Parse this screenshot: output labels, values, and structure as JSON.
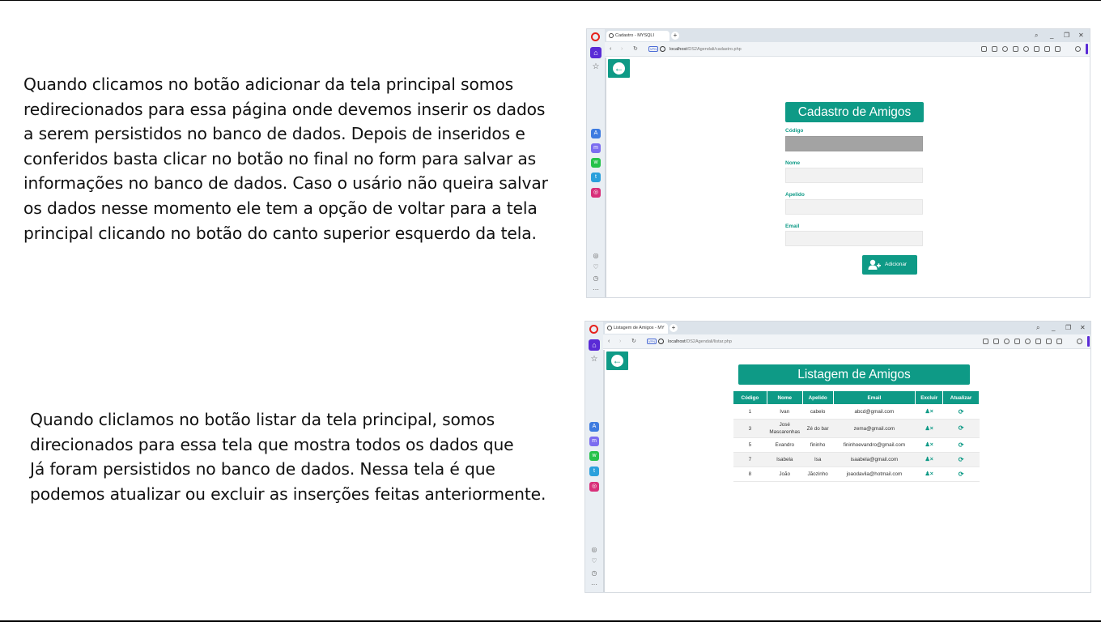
{
  "paragraph1": [
    "Quando clicamos no botão adicionar da tela principal somos",
    "redirecionados para essa página onde devemos inserir os dados",
    "a serem persistidos no banco de dados. Depois de inseridos e",
    "conferidos basta clicar no botão no final no form para salvar as",
    "informações no banco de dados. Caso o usário não queira salvar",
    "os dados nesse momento ele tem a opção de voltar para a tela",
    "principal clicando no botão do canto superior esquerdo da tela."
  ],
  "paragraph2": [
    "Quando cliclamos no botão listar da tela principal, somos",
    "direcionados para essa tela que mostra todos os dados que",
    "Já foram persistidos no banco de dados. Nessa tela é que",
    "podemos atualizar ou excluir as inserções feitas anteriormente."
  ],
  "browser1": {
    "tab_title": "Cadastro - MYSQLI",
    "url_host": "localhost",
    "url_path": "/DS2Agendali/cadastro.php"
  },
  "browser2": {
    "tab_title": "Listagem de Amigos - MY",
    "url_host": "localhost",
    "url_path": "/DS2Agendali/listar.php"
  },
  "cadastro": {
    "title": "Cadastro de Amigos",
    "fields": [
      {
        "label": "Código",
        "value": ""
      },
      {
        "label": "Nome",
        "value": ""
      },
      {
        "label": "Apelido",
        "value": ""
      },
      {
        "label": "Email",
        "value": ""
      }
    ],
    "submit_label": "Adicionar"
  },
  "listagem": {
    "title": "Listagem de Amigos",
    "columns": [
      "Código",
      "Nome",
      "Apelido",
      "Email",
      "Excluir",
      "Atualizar"
    ],
    "rows": [
      {
        "codigo": "1",
        "nome": "Ivan",
        "apelido": "cabelo",
        "email": "abcd@gmail.com"
      },
      {
        "codigo": "3",
        "nome": "José Mascarenhas",
        "apelido": "Zé do bar",
        "email": "zema@gmail.com"
      },
      {
        "codigo": "5",
        "nome": "Evandro",
        "apelido": "fininho",
        "email": "fininhoevandro@gmail.com"
      },
      {
        "codigo": "7",
        "nome": "Isabela",
        "apelido": "Isa",
        "email": "isaabela@gmail.com"
      },
      {
        "codigo": "8",
        "nome": "João",
        "apelido": "Jãozinho",
        "email": "joaodavila@hotmail.com"
      }
    ]
  },
  "colors": {
    "accent": "#0e9a86",
    "opera_red": "#e6211c",
    "sidebar_purple": "#5a2bd6"
  },
  "icons": {
    "back": "arrow-left-circle-icon",
    "add_user": "user-plus-icon",
    "delete": "user-times-icon",
    "update": "refresh-icon"
  }
}
